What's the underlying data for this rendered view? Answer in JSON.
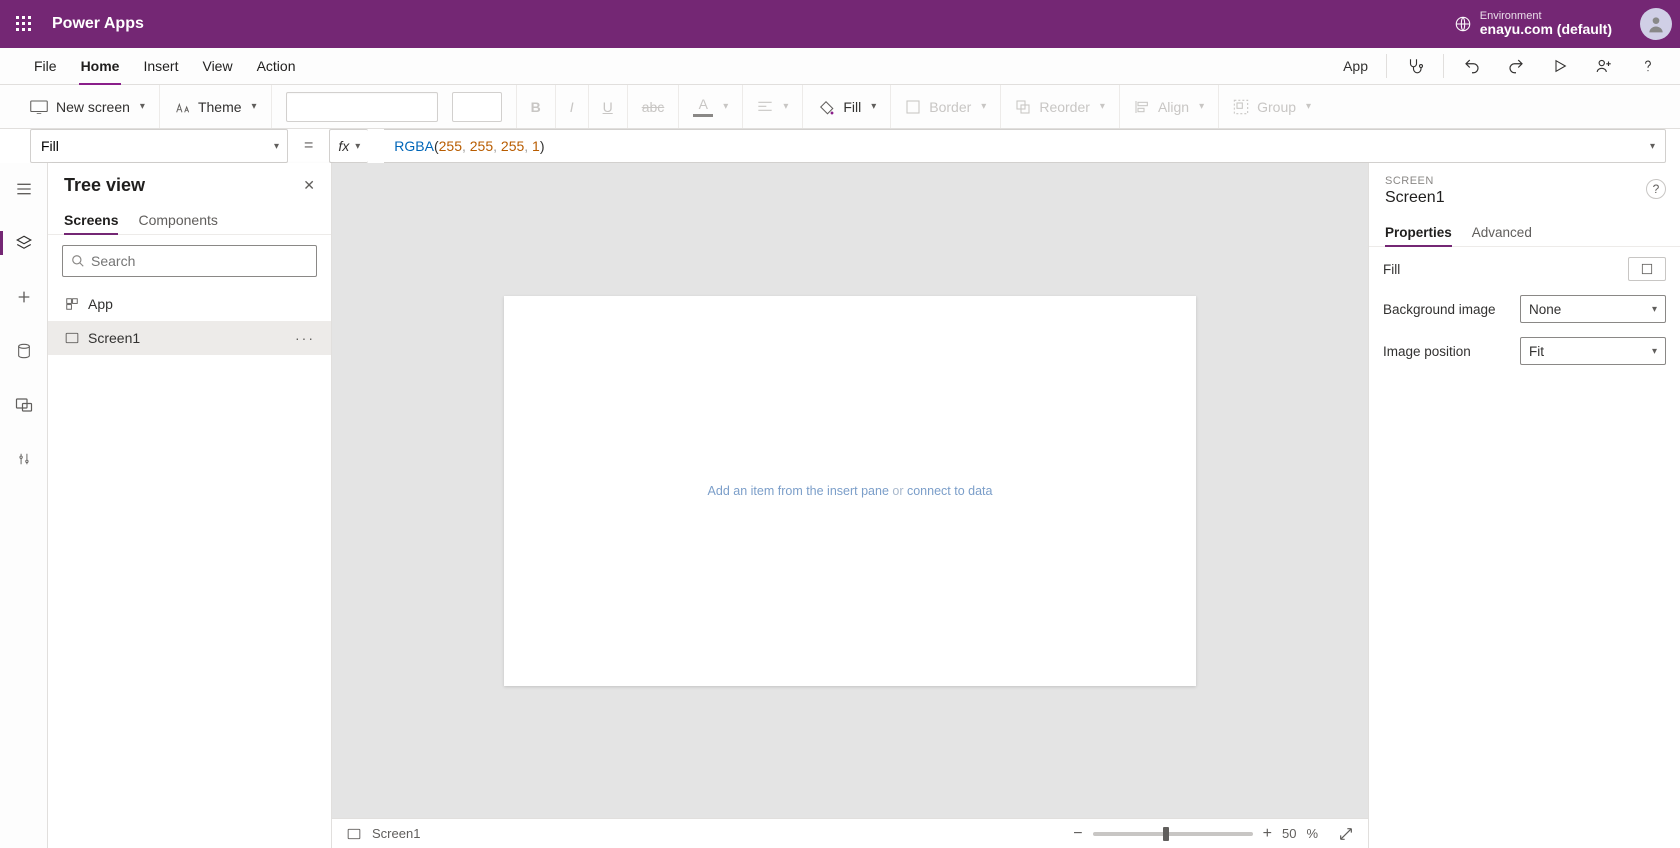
{
  "topbar": {
    "app_title": "Power Apps",
    "env_label": "Environment",
    "env_name": "enayu.com (default)"
  },
  "menubar": {
    "items": [
      "File",
      "Home",
      "Insert",
      "View",
      "Action"
    ],
    "active_index": 1,
    "app_label": "App"
  },
  "ribbon": {
    "new_screen": "New screen",
    "theme": "Theme",
    "bold": "B",
    "italic": "I",
    "underline": "U",
    "font_color_letter": "A",
    "fill": "Fill",
    "border": "Border",
    "reorder": "Reorder",
    "align": "Align",
    "group": "Group"
  },
  "formula": {
    "property": "Fill",
    "fx": "fx",
    "fn": "RGBA",
    "args": [
      "255",
      "255",
      "255",
      "1"
    ]
  },
  "tree": {
    "title": "Tree view",
    "tabs": [
      "Screens",
      "Components"
    ],
    "active_tab": 0,
    "search_placeholder": "Search",
    "items": [
      {
        "label": "App",
        "icon": "app"
      },
      {
        "label": "Screen1",
        "icon": "screen",
        "selected": true
      }
    ]
  },
  "canvas": {
    "hint_link_left": "Add an item from the insert pane",
    "hint_mid": " or ",
    "hint_link_right": "connect to data"
  },
  "statusbar": {
    "label": "Screen1",
    "zoom": "50",
    "zoom_suffix": "%"
  },
  "properties": {
    "type_label": "SCREEN",
    "name": "Screen1",
    "tabs": [
      "Properties",
      "Advanced"
    ],
    "active_tab": 0,
    "rows": {
      "fill_label": "Fill",
      "bg_label": "Background image",
      "bg_value": "None",
      "imgpos_label": "Image position",
      "imgpos_value": "Fit"
    }
  }
}
